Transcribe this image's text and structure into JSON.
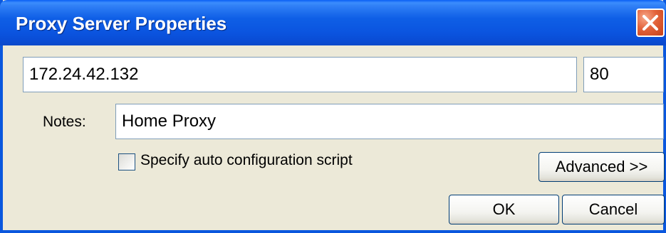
{
  "window": {
    "title": "Proxy Server Properties"
  },
  "proxy": {
    "address": "172.24.42.132",
    "port": "80"
  },
  "notes": {
    "label": "Notes:",
    "value": "Home Proxy"
  },
  "auto_config": {
    "label": "Specify auto configuration script",
    "checked": false
  },
  "buttons": {
    "advanced": "Advanced >>",
    "ok": "OK",
    "cancel": "Cancel"
  },
  "icons": {
    "close": "close-icon"
  },
  "colors": {
    "titlebar": "#0a5ff5",
    "close_button": "#e3633b",
    "dialog_background": "#ece9d8",
    "field_border": "#7f9db9"
  }
}
